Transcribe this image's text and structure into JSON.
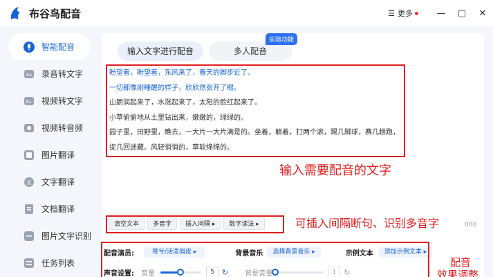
{
  "app": {
    "title": "布谷鸟配音",
    "more_label": "更多"
  },
  "window_controls": {
    "minimize": "—",
    "maximize": "▢",
    "close": "✕"
  },
  "sidebar": {
    "items": [
      {
        "label": "智能配音",
        "icon": "mic-icon",
        "active": true
      },
      {
        "label": "录音转文字",
        "icon": "audio-text-icon"
      },
      {
        "label": "视频转文字",
        "icon": "video-text-icon"
      },
      {
        "label": "视频转音频",
        "icon": "video-audio-icon"
      },
      {
        "label": "图片翻译",
        "icon": "image-translate-icon"
      },
      {
        "label": "文字翻译",
        "icon": "text-translate-icon"
      },
      {
        "label": "文档翻译",
        "icon": "doc-translate-icon"
      },
      {
        "label": "图片文字识别",
        "icon": "ocr-icon"
      },
      {
        "label": "任务列表",
        "icon": "task-list-icon"
      }
    ]
  },
  "main": {
    "tabs": [
      {
        "label": "输入文字进行配音",
        "active": true
      },
      {
        "label": "多人配音",
        "active": false
      }
    ],
    "lab_badge": "实验功能",
    "text_lines": [
      "盼望着，盼望着，东风来了，春天的脚步近了。",
      "一切都像刚睡醒的样子，欣欣然张开了眼。",
      "山朗润起来了，水涨起来了，太阳的脸红起来了。",
      "小草偷偷地从土里钻出来，嫩嫩的，绿绿的。",
      "园子里，田野里，瞧去，一大片一大片满是的。坐着，躺着，打两个滚，踢几脚球，赛几趟跑，",
      "捉几回迷藏。风轻悄悄的，草软绵绵的。"
    ],
    "toolbar": [
      "清空文本",
      "多音字",
      "插入间隔 ▸",
      "数字读法 ▸"
    ],
    "char_count": "000",
    "settings": {
      "voice_label": "配音演员:",
      "voice_value": "蒂兮/活泼俏皮 ▸",
      "bgm_label": "背景音乐",
      "bgm_value": "选择背景音乐 ▸",
      "sample_label": "示例文本",
      "sample_value": "添加示例文本 ▸",
      "sound_label": "声音设置:",
      "volume_label": "音量",
      "volume_value": "5",
      "volume_level": 0.5,
      "bg_volume_label": "背景音量",
      "bg_volume_value": "1",
      "bg_volume_level": 0
    }
  },
  "annotations": {
    "input_text": "输入需要配音的文字",
    "insert_tools": "可插入间隔断句、识别多音字",
    "effect_line1": "配音",
    "effect_line2": "效果调整"
  },
  "colors": {
    "accent": "#1663d6",
    "annotation_red": "#e01e1e",
    "badge_blue": "#2d6ff0"
  }
}
